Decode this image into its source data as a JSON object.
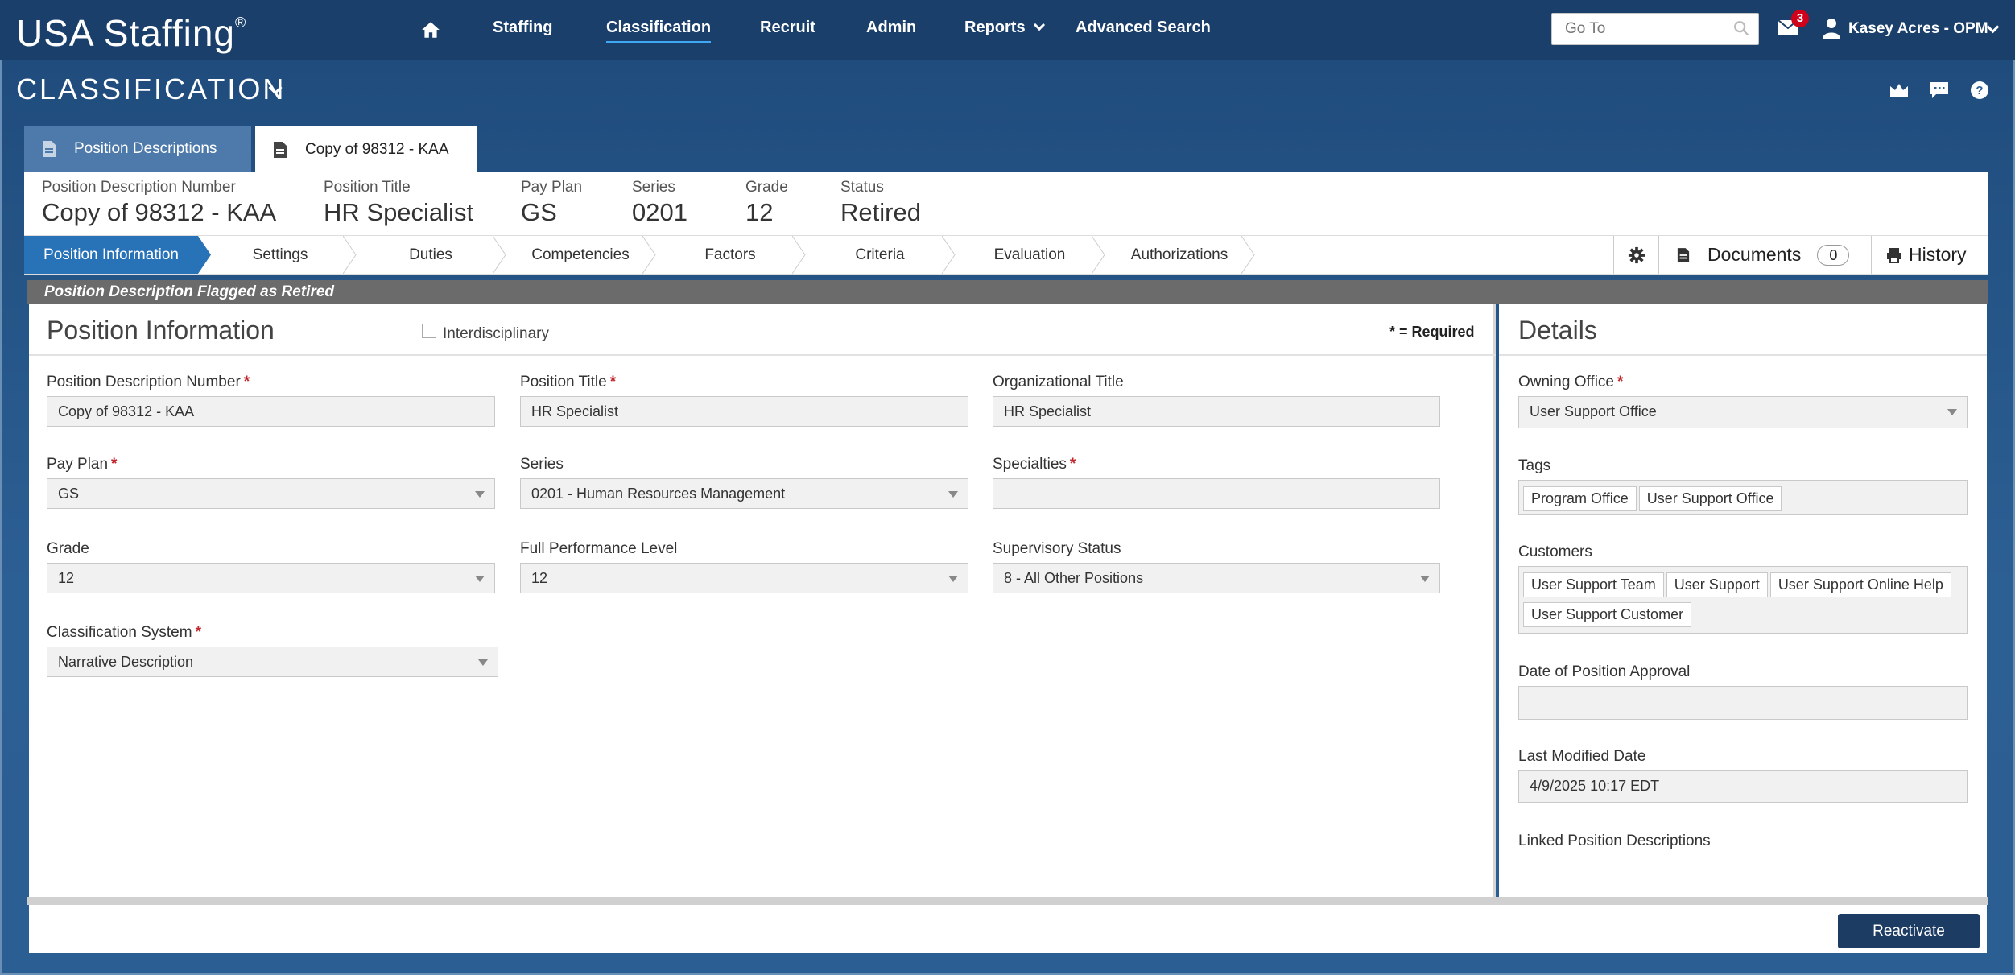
{
  "app": {
    "brand": "USA Staffing",
    "brand_mark": "®",
    "module": "CLASSIFICATION"
  },
  "topnav": {
    "items": [
      "Staffing",
      "Classification",
      "Recruit",
      "Admin",
      "Reports",
      "Advanced Search"
    ],
    "active": "Classification",
    "goto_placeholder": "Go To",
    "mail_count": "3",
    "user": "Kasey Acres - OPM"
  },
  "tabs": [
    {
      "label": "Position Descriptions",
      "icon": "document-icon"
    },
    {
      "label": "Copy of 98312 - KAA",
      "icon": "document-icon"
    }
  ],
  "header": {
    "fields": [
      {
        "label": "Position Description Number",
        "value": "Copy of 98312 - KAA"
      },
      {
        "label": "Position Title",
        "value": "HR Specialist"
      },
      {
        "label": "Pay Plan",
        "value": "GS"
      },
      {
        "label": "Series",
        "value": "0201"
      },
      {
        "label": "Grade",
        "value": "12"
      },
      {
        "label": "Status",
        "value": "Retired"
      }
    ]
  },
  "steps": [
    "Position Information",
    "Settings",
    "Duties",
    "Competencies",
    "Factors",
    "Criteria",
    "Evaluation",
    "Authorizations"
  ],
  "active_step": "Position Information",
  "tools": {
    "documents_label": "Documents",
    "documents_count": "0",
    "history_label": "History"
  },
  "banner": "Position Description Flagged as Retired",
  "main": {
    "title": "Position Information",
    "interdisciplinary_label": "Interdisciplinary",
    "required_note": "* = Required",
    "fields": {
      "pd_number": {
        "label": "Position Description Number",
        "value": "Copy of 98312 - KAA"
      },
      "position_title": {
        "label": "Position Title",
        "value": "HR Specialist"
      },
      "org_title": {
        "label": "Organizational Title",
        "value": "HR Specialist"
      },
      "pay_plan": {
        "label": "Pay Plan",
        "value": "GS"
      },
      "series": {
        "label": "Series",
        "value": "0201 - Human Resources Management"
      },
      "specialties": {
        "label": "Specialties",
        "value": ""
      },
      "grade": {
        "label": "Grade",
        "value": "12"
      },
      "full_perf": {
        "label": "Full Performance Level",
        "value": "12"
      },
      "supervisory": {
        "label": "Supervisory Status",
        "value": "8 - All Other Positions"
      },
      "class_system": {
        "label": "Classification System",
        "value": "Narrative Description"
      }
    }
  },
  "details": {
    "title": "Details",
    "owning_office": {
      "label": "Owning Office",
      "value": "User Support Office"
    },
    "tags": {
      "label": "Tags",
      "values": [
        "Program Office",
        "User Support Office"
      ]
    },
    "customers": {
      "label": "Customers",
      "values": [
        "User Support Team",
        "User Support",
        "User Support Online Help",
        "User Support Customer"
      ]
    },
    "approval_date": {
      "label": "Date of Position Approval",
      "value": ""
    },
    "last_modified": {
      "label": "Last Modified Date",
      "value": "4/9/2025 10:17 EDT"
    },
    "linked_label": "Linked Position Descriptions"
  },
  "footer": {
    "reactivate_label": "Reactivate"
  },
  "star": "*",
  "colors": {
    "nav_bg": "#1a3f6b",
    "active_step": "#2872b8",
    "banner": "#6b6b6b",
    "button": "#1d3c63",
    "badge": "#d0021b"
  }
}
